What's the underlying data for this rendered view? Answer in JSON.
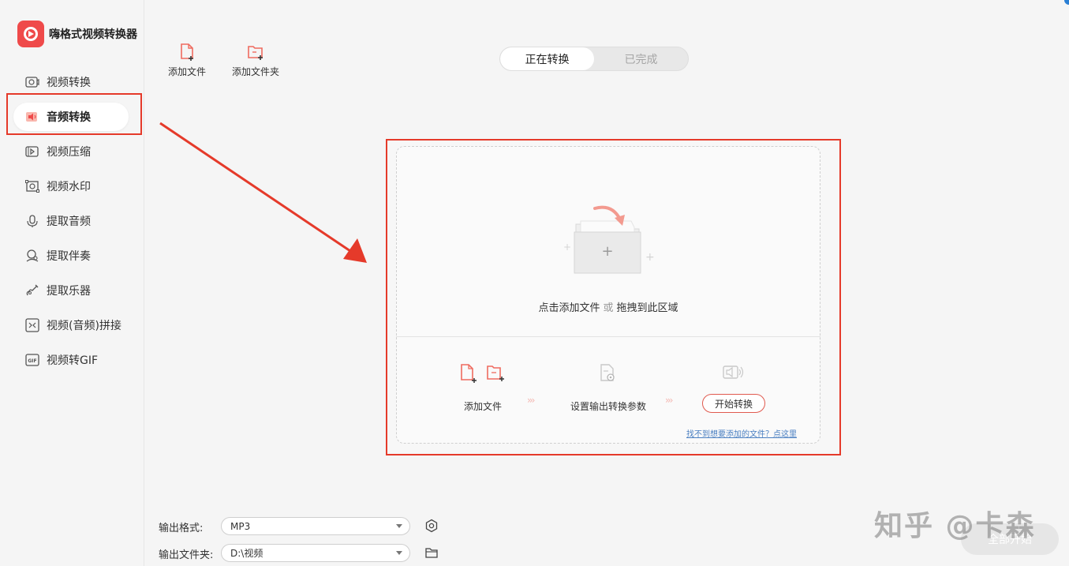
{
  "app": {
    "title": "嗨格式视频转换器"
  },
  "colors": {
    "accent": "#e53a2a",
    "brand": "#ef4a4a",
    "link": "#4a7fc1"
  },
  "sidebar": {
    "items": [
      {
        "label": "视频转换",
        "icon": "video-convert-icon"
      },
      {
        "label": "音频转换",
        "icon": "audio-convert-icon",
        "active": true
      },
      {
        "label": "视频压缩",
        "icon": "video-compress-icon"
      },
      {
        "label": "视频水印",
        "icon": "video-watermark-icon"
      },
      {
        "label": "提取音频",
        "icon": "extract-audio-icon"
      },
      {
        "label": "提取伴奏",
        "icon": "extract-accompaniment-icon"
      },
      {
        "label": "提取乐器",
        "icon": "extract-instrument-icon"
      },
      {
        "label": "视频(音频)拼接",
        "icon": "merge-icon"
      },
      {
        "label": "视频转GIF",
        "icon": "gif-icon"
      }
    ]
  },
  "toolbar": {
    "add_file": "添加文件",
    "add_folder": "添加文件夹"
  },
  "tabs": [
    {
      "label": "正在转换",
      "selected": true
    },
    {
      "label": "已完成",
      "selected": false
    }
  ],
  "dropzone": {
    "hint_click": "点击添加文件",
    "hint_or": "或",
    "hint_drag": "拖拽到此区域",
    "steps": {
      "add_file": "添加文件",
      "set_params": "设置输出转换参数",
      "start": "开始转换"
    },
    "help_link": "找不到想要添加的文件？点这里"
  },
  "bottom": {
    "format_label": "输出格式:",
    "format_value": "MP3",
    "folder_label": "输出文件夹:",
    "folder_value": "D:\\视频",
    "start_all": "全部开始"
  },
  "watermark": {
    "text": "知乎 @卡森"
  }
}
